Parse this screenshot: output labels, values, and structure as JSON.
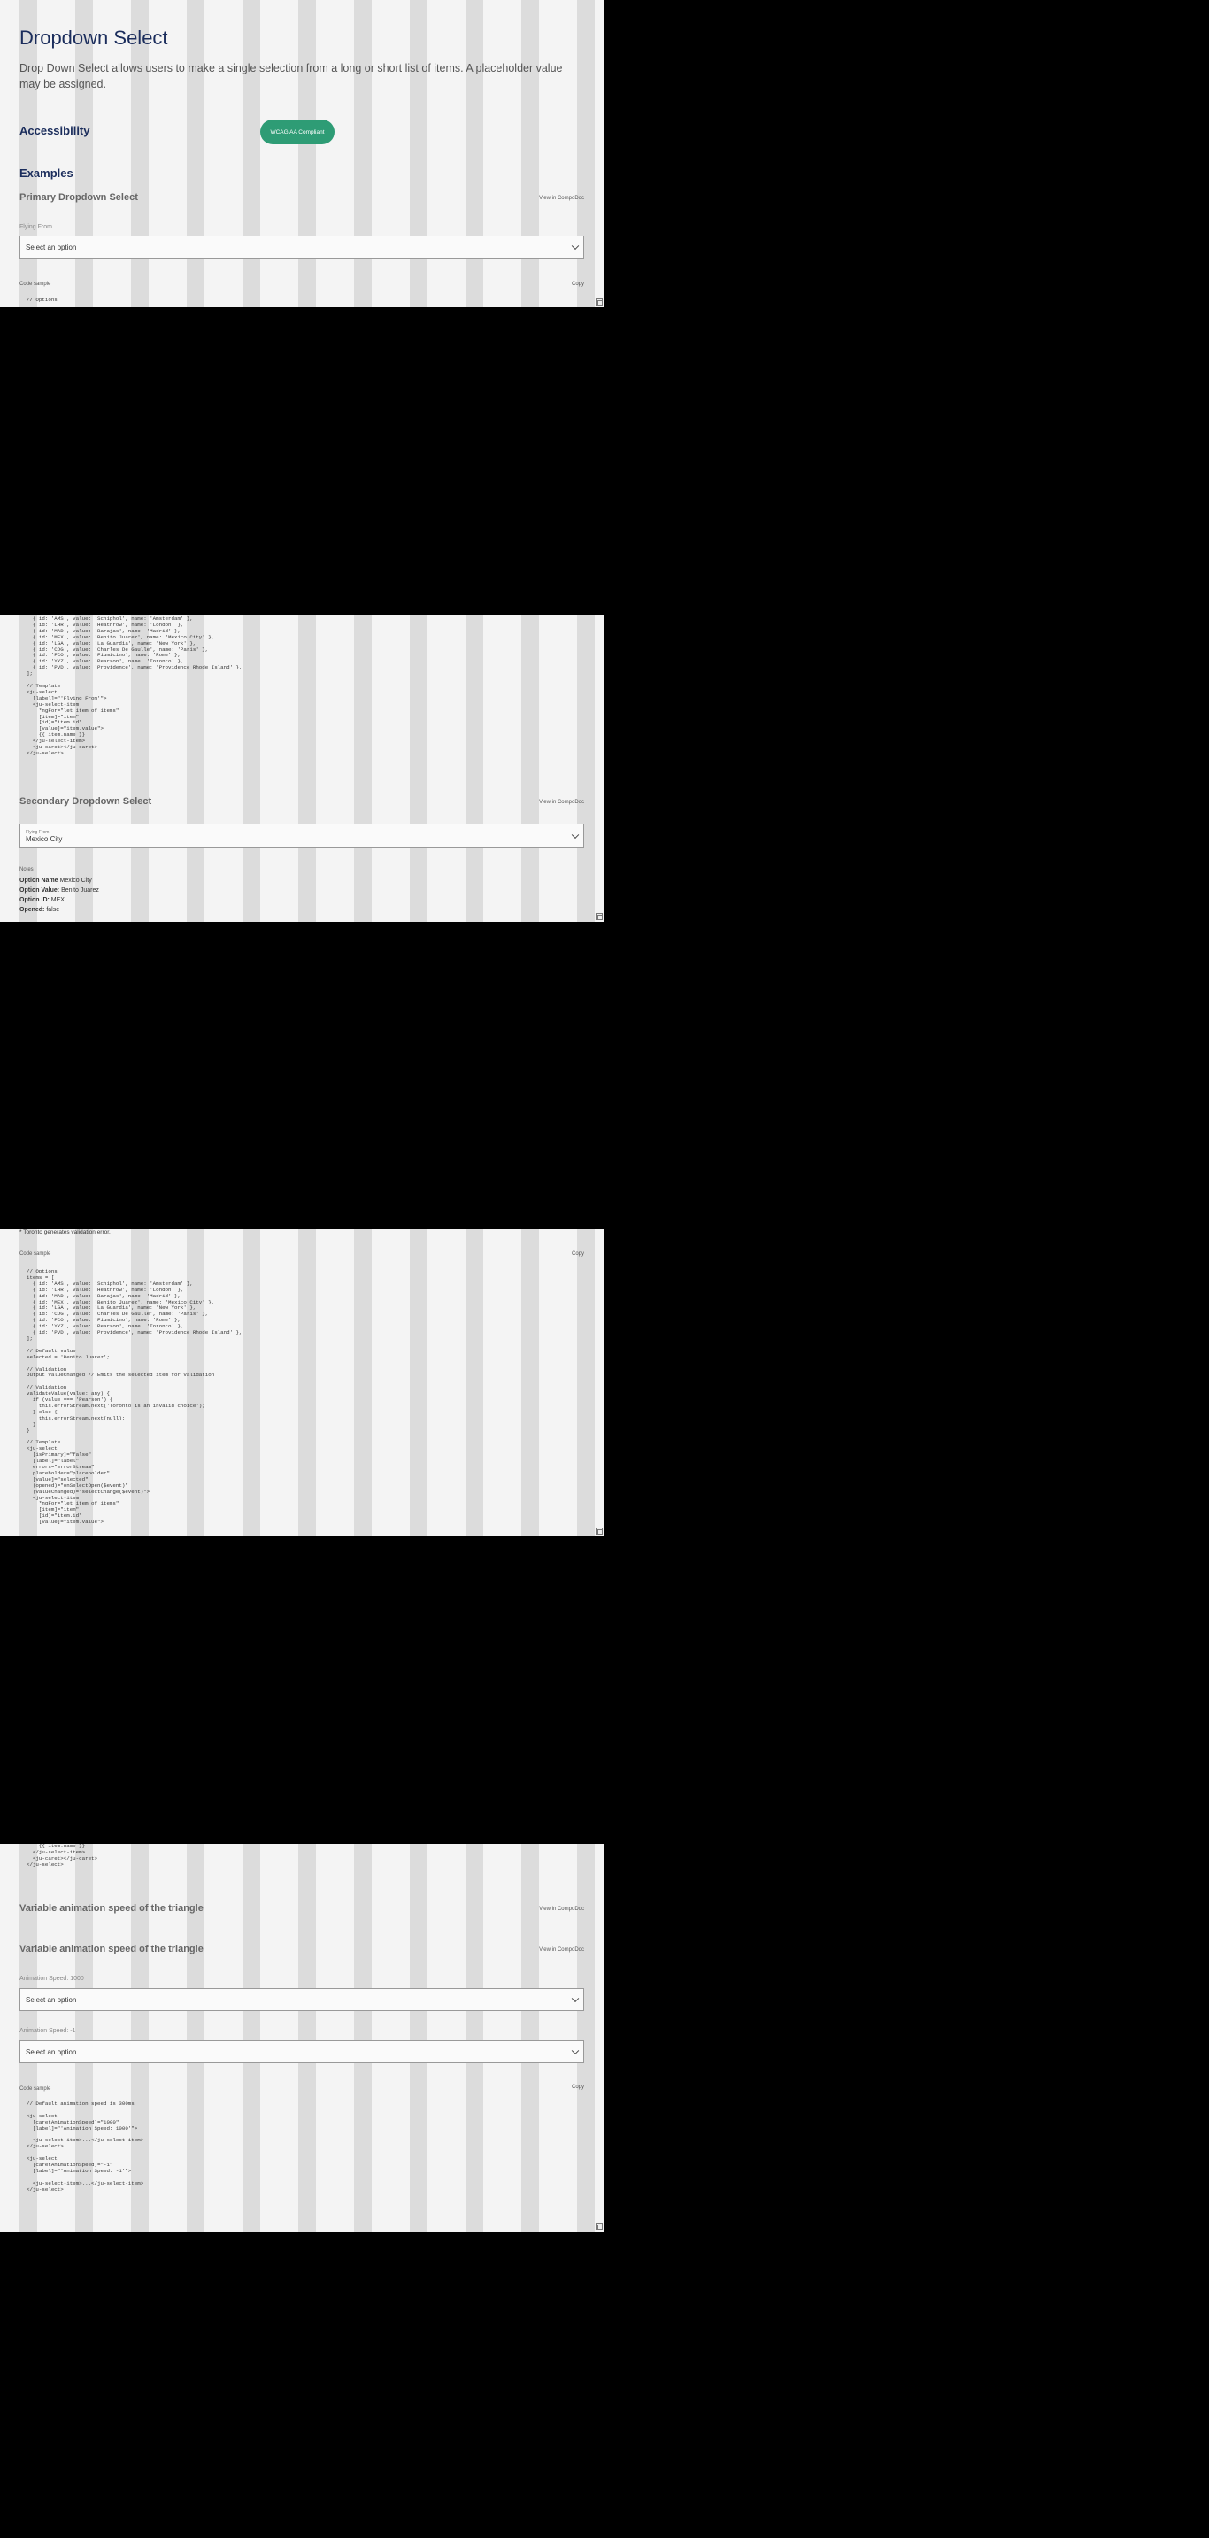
{
  "page": {
    "title": "Dropdown Select",
    "description": "Drop Down Select allows users to make a single selection from a long or short list of items. A placeholder value may be assigned."
  },
  "accessibility": {
    "heading": "Accessibility",
    "badge": "WCAG AA Compliant"
  },
  "examples": {
    "heading": "Examples"
  },
  "primary": {
    "heading": "Primary Dropdown Select",
    "view_link": "View in CompoDoc",
    "field_label": "Flying From",
    "placeholder": "Select an option",
    "code_label": "Code sample",
    "copy_label": "Copy",
    "code_top": "// Options",
    "code_bottom": "  { id: 'AMS', value: 'Schiphol', name: 'Amsterdam' },\n  { id: 'LHR', value: 'Heathrow', name: 'London' },\n  { id: 'MAD', value: 'Barajas', name: 'Madrid' },\n  { id: 'MEX', value: 'Benito Juarez', name: 'Mexico City' },\n  { id: 'LGA', value: 'La Guardia', name: 'New York' },\n  { id: 'CDG', value: 'Charles De Gaulle', name: 'Paris' },\n  { id: 'FCO', value: 'Fiumicino', name: 'Rome' },\n  { id: 'YYZ', value: 'Pearson', name: 'Toronto' },\n  { id: 'PVD', value: 'Providence', name: 'Providence Rhode Island' },\n];\n\n// Template\n<ju-select\n  [label]=\"'Flying From'\">\n  <ju-select-item\n    *ngFor=\"let item of items\"\n    [item]=\"item\"\n    [id]=\"item.id\"\n    [value]=\"item.value\">\n    {{ item.name }}\n  </ju-select-item>\n  <ju-caret></ju-caret>\n</ju-select>"
  },
  "secondary": {
    "heading": "Secondary Dropdown Select",
    "view_link": "View in CompoDoc",
    "field_label": "Flying From",
    "value": "Mexico City",
    "notes_label": "Notes",
    "notes": [
      {
        "key": "Option Name",
        "value": "Mexico City"
      },
      {
        "key": "Option Value:",
        "value": "Benito Juarez"
      },
      {
        "key": "Option ID:",
        "value": "MEX"
      },
      {
        "key": "Opened:",
        "value": "false"
      }
    ],
    "validation_note": "* Toronto generates validation error.",
    "code_label": "Code sample",
    "copy_label": "Copy",
    "code": "// Options\nitems = [\n  { id: 'AMS', value: 'Schiphol', name: 'Amsterdam' },\n  { id: 'LHR', value: 'Heathrow', name: 'London' },\n  { id: 'MAD', value: 'Barajas', name: 'Madrid' },\n  { id: 'MEX', value: 'Benito Juarez', name: 'Mexico City' },\n  { id: 'LGA', value: 'La Guardia', name: 'New York' },\n  { id: 'CDG', value: 'Charles De Gaulle', name: 'Paris' },\n  { id: 'FCO', value: 'Fiumicino', name: 'Rome' },\n  { id: 'YYZ', value: 'Pearson', name: 'Toronto' },\n  { id: 'PVD', value: 'Providence', name: 'Providence Rhode Island' },\n];\n\n// Default value\nselected = 'Benito Juarez';\n\n// Validation\nOutput valueChanged // Emits the selected item for validation\n\n// Validation\nvalidateValue(value: any) {\n  if (value === 'Pearson') {\n    this.errorStream.next('Toronto is an invalid choice');\n  } else {\n    this.errorStream.next(null);\n  }\n}\n\n// Template\n<ju-select\n  [isPrimary]=\"false\"\n  [label]=\"label\"\n  errors=\"errorStream\"\n  placeholder=\"placeholder\"\n  [value]=\"selected\"\n  (opened)=\"onSelectOpen($event)\"\n  (valueChanged)=\"selectChange($event)\">\n  <ju-select-item\n    *ngFor=\"let item of items\"\n    [item]=\"item\"\n    [id]=\"item.id\"\n    [value]=\"item.value\">",
    "code_tail": "    {{ item.name }}\n  </ju-select-item>\n  <ju-caret></ju-caret>\n</ju-select>"
  },
  "animation": {
    "heading_outer": "Variable animation speed of the triangle",
    "heading_inner": "Variable animation speed of the triangle",
    "view_link": "View in CompoDoc",
    "field1_label": "Animation Speed: 1000",
    "field1_placeholder": "Select an option",
    "field2_label": "Animation Speed: -1",
    "field2_placeholder": "Select an option",
    "code_label": "Code sample",
    "copy_label": "Copy",
    "code": "// Default animation speed is 300ms\n\n<ju-select\n  [caretAnimationSpeed]=\"1000\"\n  [label]=\"'Animation Speed: 1000'\">\n\n  <ju-select-item>...</ju-select-item>\n</ju-select>\n\n<ju-select\n  [caretAnimationSpeed]=\"-1\"\n  [label]=\"'Animation Speed: -1'\">\n\n  <ju-select-item>...</ju-select-item>\n</ju-select>"
  }
}
